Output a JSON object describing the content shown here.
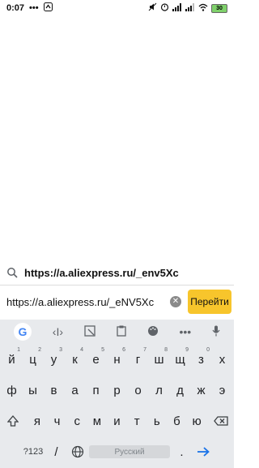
{
  "status_bar": {
    "time": "0:07",
    "battery": "30"
  },
  "suggestion": {
    "text": "https://a.aliexpress.ru/_env5Xc"
  },
  "url_bar": {
    "value": "https://a.aliexpress.ru/_eNV5Xc",
    "go_label": "Перейти"
  },
  "keyboard": {
    "row1": [
      {
        "key": "й",
        "hint": "1"
      },
      {
        "key": "ц",
        "hint": "2"
      },
      {
        "key": "у",
        "hint": "3"
      },
      {
        "key": "к",
        "hint": "4"
      },
      {
        "key": "е",
        "hint": "5"
      },
      {
        "key": "н",
        "hint": "6"
      },
      {
        "key": "г",
        "hint": "7"
      },
      {
        "key": "ш",
        "hint": "8"
      },
      {
        "key": "щ",
        "hint": "9"
      },
      {
        "key": "з",
        "hint": "0"
      },
      {
        "key": "х",
        "hint": ""
      }
    ],
    "row2": [
      "ф",
      "ы",
      "в",
      "а",
      "п",
      "р",
      "о",
      "л",
      "д",
      "ж",
      "э"
    ],
    "row3": [
      "я",
      "ч",
      "с",
      "м",
      "и",
      "т",
      "ь",
      "б",
      "ю"
    ],
    "symbols_label": "?123",
    "slash_label": "/",
    "space_label": "Русский"
  },
  "colors": {
    "accent": "#f7c52c",
    "keyboard_bg": "#e8eaed",
    "enter_blue": "#1a73e8"
  }
}
